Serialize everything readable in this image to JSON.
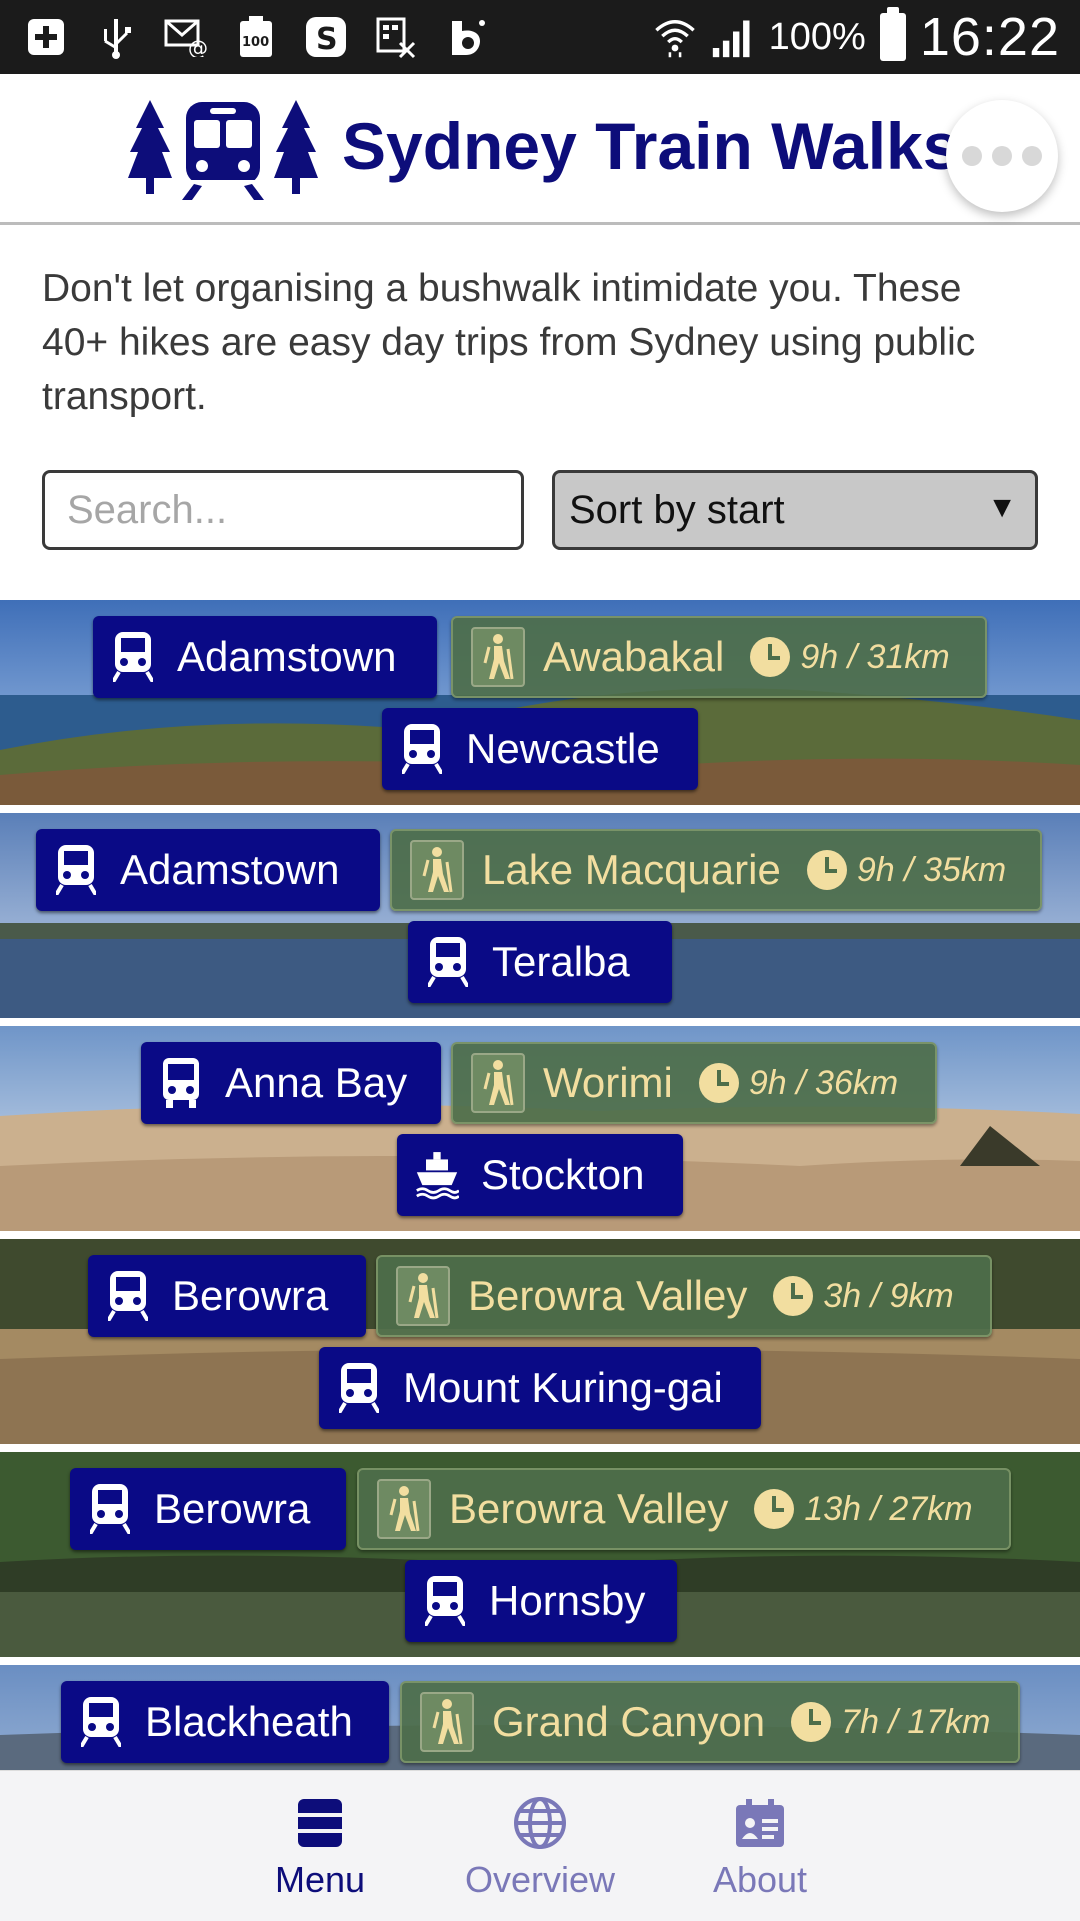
{
  "status_bar": {
    "icons": [
      "add-icon",
      "usb-icon",
      "email-icon",
      "battery-100-icon",
      "skype-icon",
      "calendar-x-icon",
      "app-icon",
      "wifi-icon",
      "signal-icon"
    ],
    "battery": "100%",
    "time": "16:22"
  },
  "header": {
    "title": "Sydney Train Walks"
  },
  "intro": "Don't let organising a bushwalk intimidate you. These 40+ hikes are easy day trips from Sydney using public transport.",
  "search": {
    "placeholder": "Search...",
    "value": ""
  },
  "sort": {
    "selected": "Sort by start",
    "arrow": "▼"
  },
  "walks": [
    {
      "start": "Adamstown",
      "start_mode": "train",
      "name": "Awabakal",
      "duration": "9h / 31km",
      "end": "Newcastle",
      "end_mode": "train"
    },
    {
      "start": "Adamstown",
      "start_mode": "train",
      "name": "Lake Macquarie",
      "duration": "9h / 35km",
      "end": "Teralba",
      "end_mode": "train"
    },
    {
      "start": "Anna Bay",
      "start_mode": "bus",
      "name": "Worimi",
      "duration": "9h / 36km",
      "end": "Stockton",
      "end_mode": "ferry"
    },
    {
      "start": "Berowra",
      "start_mode": "train",
      "name": "Berowra Valley",
      "duration": "3h / 9km",
      "end": "Mount Kuring-gai",
      "end_mode": "train"
    },
    {
      "start": "Berowra",
      "start_mode": "train",
      "name": "Berowra Valley",
      "duration": "13h / 27km",
      "end": "Hornsby",
      "end_mode": "train"
    },
    {
      "start": "Blackheath",
      "start_mode": "train",
      "name": "Grand Canyon",
      "duration": "7h / 17km",
      "end": "",
      "end_mode": ""
    }
  ],
  "bottom_nav": [
    {
      "label": "Menu",
      "icon": "menu-icon",
      "active": true
    },
    {
      "label": "Overview",
      "icon": "globe-icon",
      "active": false
    },
    {
      "label": "About",
      "icon": "contact-card-icon",
      "active": false
    }
  ],
  "colors": {
    "brand_navy": "#0d0d7a",
    "chip_blue": "#0a0a86",
    "chip_green": "#4e6e4a",
    "chip_green_text": "#f2dea0",
    "nav_inactive": "#7a78b8"
  }
}
